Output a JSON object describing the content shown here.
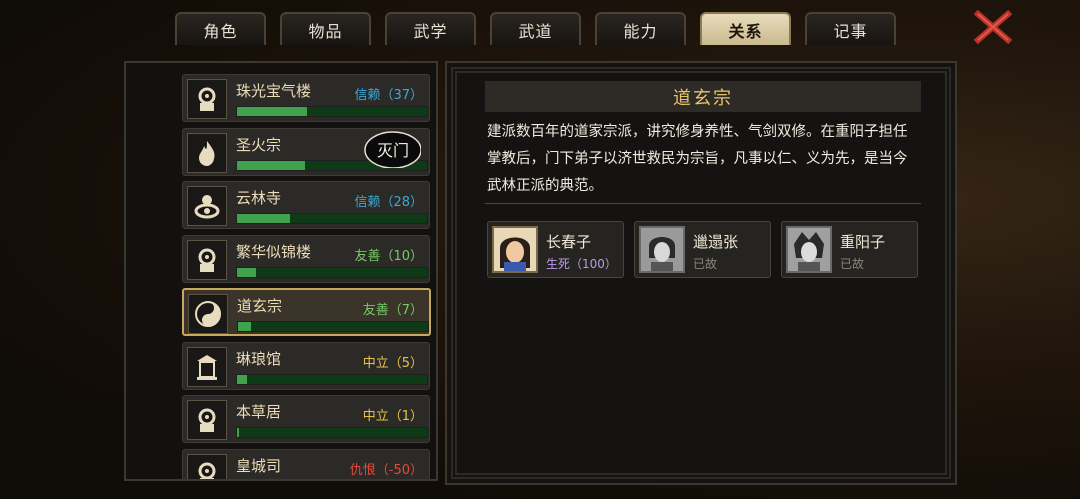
{
  "tabs": [
    {
      "label": "角色"
    },
    {
      "label": "物品"
    },
    {
      "label": "武学"
    },
    {
      "label": "武道"
    },
    {
      "label": "能力"
    },
    {
      "label": "关系",
      "active": true
    },
    {
      "label": "记事"
    }
  ],
  "sects": [
    {
      "name": "珠光宝气楼",
      "relation": "信赖（37）",
      "relation_color": "#3aa8d8",
      "progress": 0.37,
      "icon": "ornate-emblem-icon"
    },
    {
      "name": "圣火宗",
      "relation": "",
      "relation_color": "#3aa8d8",
      "progress": 0.36,
      "icon": "flame-icon",
      "stamp": "灭门"
    },
    {
      "name": "云林寺",
      "relation": "信赖（28）",
      "relation_color": "#3aa8d8",
      "progress": 0.28,
      "icon": "lotus-icon"
    },
    {
      "name": "繁华似锦楼",
      "relation": "友善（10）",
      "relation_color": "#7ac86a",
      "progress": 0.1,
      "icon": "ornate-emblem-icon"
    },
    {
      "name": "道玄宗",
      "relation": "友善（7）",
      "relation_color": "#7ac86a",
      "progress": 0.07,
      "icon": "yin-yang-icon",
      "selected": true
    },
    {
      "name": "琳琅馆",
      "relation": "中立（5）",
      "relation_color": "#e6c24a",
      "progress": 0.05,
      "icon": "pavilion-icon"
    },
    {
      "name": "本草居",
      "relation": "中立（1）",
      "relation_color": "#e6c24a",
      "progress": 0.01,
      "icon": "ornate-emblem-icon"
    },
    {
      "name": "皇城司",
      "relation": "仇恨（-50）",
      "relation_color": "#e04a3a",
      "progress": 0.0,
      "icon": "ornate-emblem-icon"
    }
  ],
  "detail": {
    "title": "道玄宗",
    "description": "建派数百年的道家宗派，讲究修身养性、气剑双修。在重阳子担任掌教后，门下弟子以济世救民为宗旨，凡事以仁、义为先，是当今武林正派的典范。",
    "members": [
      {
        "name": "长春子",
        "status": "生死（100）",
        "status_color": "#b89ae8",
        "alive": true
      },
      {
        "name": "邋遢张",
        "status": "已故",
        "status_color": "#8a857c",
        "alive": false
      },
      {
        "name": "重阳子",
        "status": "已故",
        "status_color": "#8a857c",
        "alive": false
      }
    ]
  }
}
